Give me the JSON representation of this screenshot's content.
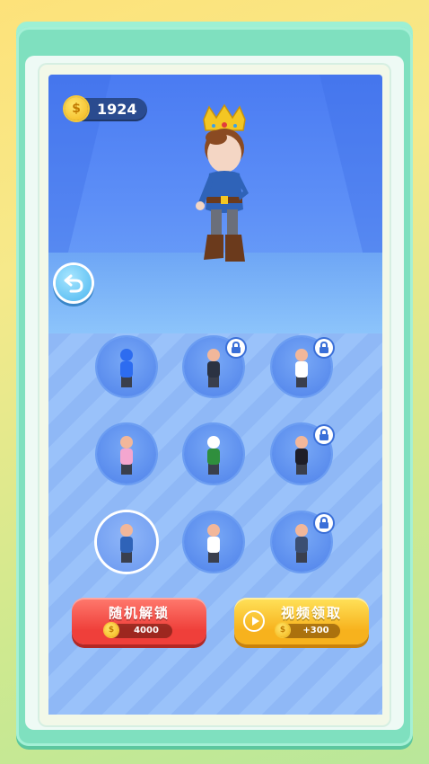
{
  "currency": {
    "symbol": "$",
    "amount": "1924",
    "icon": "coin-icon"
  },
  "back_button": {
    "icon": "back-arrow-icon"
  },
  "hero": {
    "name": "prince",
    "accessory": "crown"
  },
  "skins": [
    {
      "id": "blue-default",
      "locked": false,
      "selected": false,
      "colors": {
        "body": "#2d6cf0",
        "head": "#2d6cf0"
      }
    },
    {
      "id": "business",
      "locked": true,
      "selected": false,
      "colors": {
        "body": "#2b3242",
        "head": "#f2b79a"
      }
    },
    {
      "id": "chef",
      "locked": true,
      "selected": false,
      "colors": {
        "body": "#ffffff",
        "head": "#f2b79a"
      }
    },
    {
      "id": "fairy",
      "locked": false,
      "selected": false,
      "colors": {
        "body": "#f4a6cf",
        "head": "#f2b79a"
      }
    },
    {
      "id": "clown",
      "locked": false,
      "selected": false,
      "colors": {
        "body": "#2f8f3d",
        "head": "#ffffff"
      }
    },
    {
      "id": "magician",
      "locked": true,
      "selected": false,
      "colors": {
        "body": "#1e1e28",
        "head": "#f2b79a"
      }
    },
    {
      "id": "prince",
      "locked": false,
      "selected": true,
      "colors": {
        "body": "#2f63b8",
        "head": "#f2b79a"
      }
    },
    {
      "id": "karate",
      "locked": false,
      "selected": false,
      "colors": {
        "body": "#ffffff",
        "head": "#f2b79a"
      }
    },
    {
      "id": "qing-official",
      "locked": true,
      "selected": false,
      "colors": {
        "body": "#3b4f73",
        "head": "#f2b79a"
      }
    }
  ],
  "actions": {
    "random_unlock": {
      "label": "随机解锁",
      "price": "4000"
    },
    "video_claim": {
      "label": "视频领取",
      "reward": "+300"
    }
  },
  "colors": {
    "accent_red": "#ef3f3a",
    "accent_yellow": "#f7b21d",
    "stage_blue": "#4a7bf2"
  }
}
